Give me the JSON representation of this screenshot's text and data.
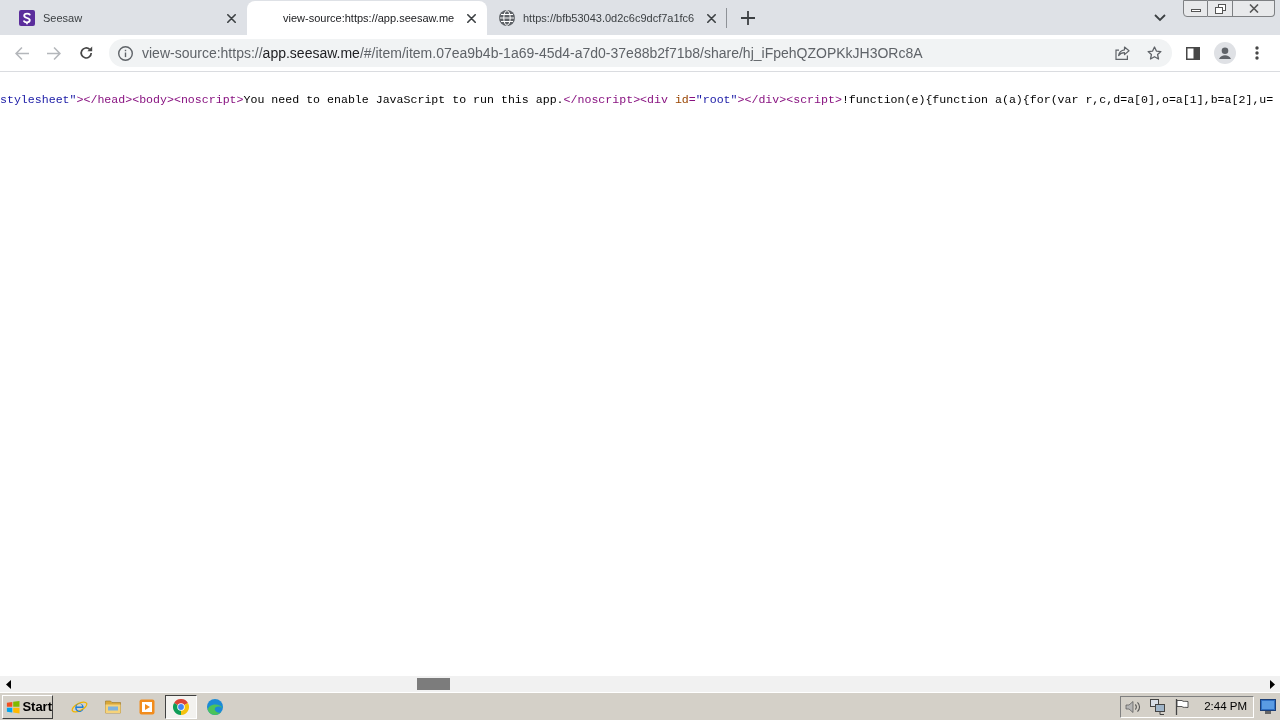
{
  "tabs": [
    {
      "kind": "seesaw",
      "title": "Seesaw",
      "selected": false
    },
    {
      "kind": "blank",
      "title": "view-source:https://app.seesaw.me",
      "selected": true
    },
    {
      "kind": "globe",
      "title": "https://bfb53043.0d2c6c9dcf7a1fc6",
      "selected": false
    }
  ],
  "toolbar": {
    "nav_buttons": [
      {
        "kind": "back",
        "disabled": true
      },
      {
        "kind": "forward",
        "disabled": true
      },
      {
        "kind": "reload",
        "disabled": false
      }
    ],
    "address_bar": {
      "scheme": "view-source:https://",
      "host": "app.seesaw.me",
      "path": "/#/item/item.07ea9b4b-1a69-45d4-a7d0-37e88b2f71b8/share/hj_iFpehQZOPKkJH3ORc8A"
    }
  },
  "source_view": {
    "tokens": [
      {
        "kind": "attribute_value",
        "text": "stylesheet\""
      },
      {
        "kind": "tag",
        "text": "></head><body><noscript>"
      },
      {
        "kind": "text",
        "text": "You need to enable JavaScript to run this app."
      },
      {
        "kind": "tag",
        "text": "</noscript><div "
      },
      {
        "kind": "attribute_name",
        "text": "id"
      },
      {
        "kind": "tag",
        "text": "="
      },
      {
        "kind": "attribute_value",
        "text": "\"root\""
      },
      {
        "kind": "tag",
        "text": "></div><script>"
      },
      {
        "kind": "text",
        "text": "!function(e){function a(a){for(var r,c,d=a[0],o=a[1],b=a[2],u="
      }
    ]
  },
  "taskbar": {
    "start_label": "Start",
    "apps": [
      {
        "kind": "ie",
        "selected": false
      },
      {
        "kind": "folder",
        "selected": false
      },
      {
        "kind": "media",
        "selected": false
      },
      {
        "kind": "chrome",
        "selected": true
      },
      {
        "kind": "edge",
        "selected": false
      }
    ],
    "clock": "2:44 PM"
  }
}
